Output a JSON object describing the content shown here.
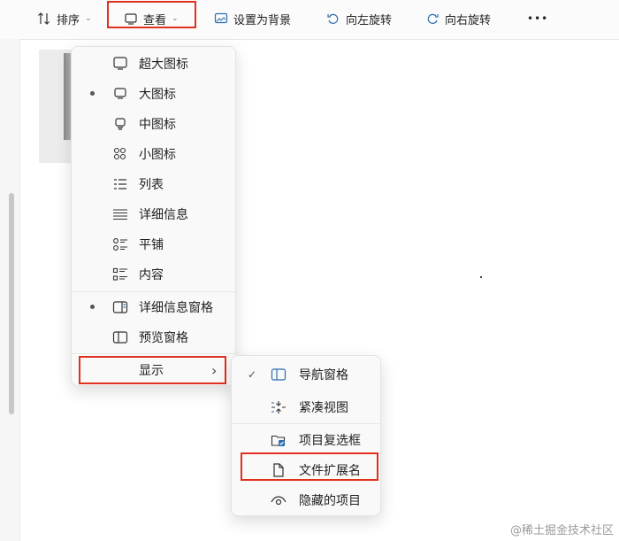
{
  "toolbar": {
    "sort_label": "排序",
    "view_label": "查看",
    "set_background_label": "设置为背景",
    "rotate_left_label": "向左旋转",
    "rotate_right_label": "向右旋转",
    "more_label": "•••"
  },
  "view_menu": {
    "items": [
      {
        "label": "超大图标",
        "icon": "monitor-icon",
        "selected": false
      },
      {
        "label": "大图标",
        "icon": "monitor-icon",
        "selected": true
      },
      {
        "label": "中图标",
        "icon": "small-monitor-icon",
        "selected": false
      },
      {
        "label": "小图标",
        "icon": "grid-icon",
        "selected": false
      },
      {
        "label": "列表",
        "icon": "list-icon",
        "selected": false
      },
      {
        "label": "详细信息",
        "icon": "details-icon",
        "selected": false
      },
      {
        "label": "平铺",
        "icon": "tiles-icon",
        "selected": false
      },
      {
        "label": "内容",
        "icon": "content-icon",
        "selected": false
      }
    ],
    "panes": [
      {
        "label": "详细信息窗格",
        "icon": "details-pane-icon",
        "selected": true
      },
      {
        "label": "预览窗格",
        "icon": "preview-pane-icon",
        "selected": false
      }
    ],
    "show_label": "显示",
    "show_arrow": "›"
  },
  "show_submenu": {
    "items": [
      {
        "label": "导航窗格",
        "icon": "navigation-pane-icon",
        "checked": true
      },
      {
        "label": "紧凑视图",
        "icon": "compact-view-icon",
        "checked": false
      },
      {
        "label": "项目复选框",
        "icon": "item-checkbox-icon",
        "checked": false
      },
      {
        "label": "文件扩展名",
        "icon": "file-icon",
        "checked": false
      },
      {
        "label": "隐藏的项目",
        "icon": "eye-icon",
        "checked": false
      }
    ],
    "check_mark": "✓"
  },
  "watermark": "@稀土掘金技术社区"
}
